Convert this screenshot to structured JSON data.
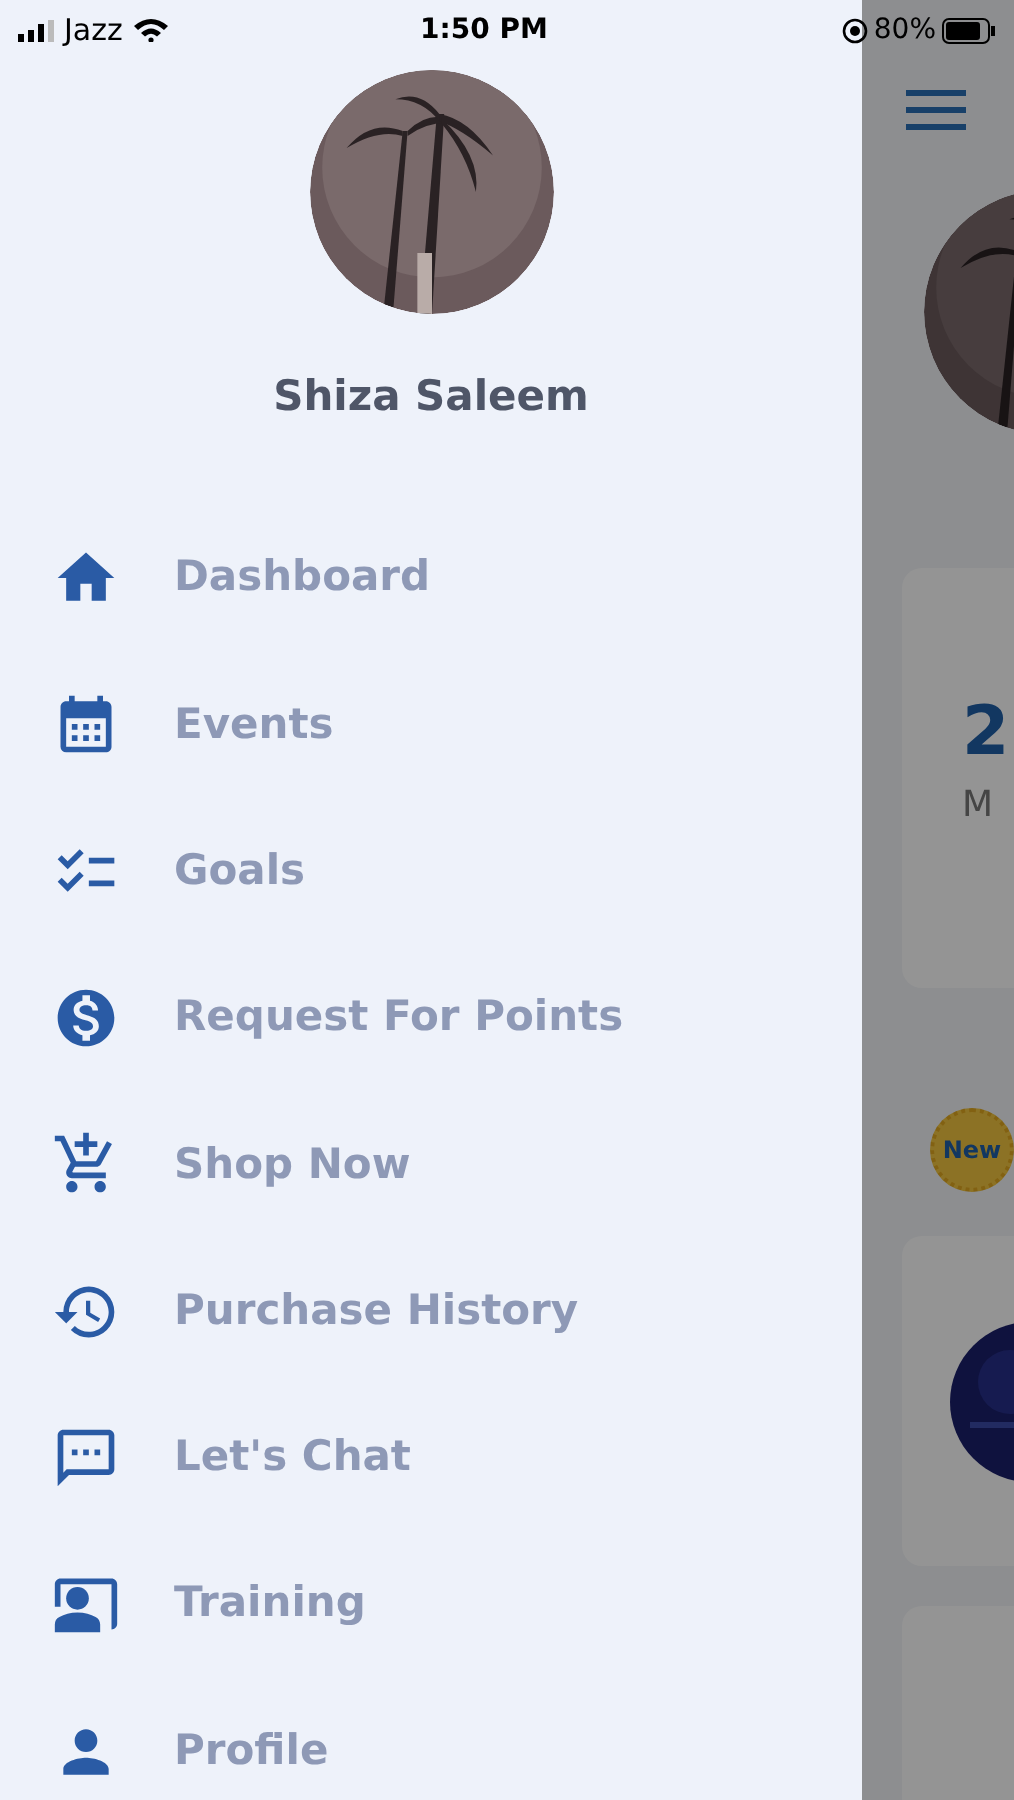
{
  "status_bar": {
    "carrier": "Jazz",
    "time": "1:50 PM",
    "battery": "80%"
  },
  "drawer": {
    "user_name": "Shiza Saleem",
    "items": [
      {
        "label": "Dashboard"
      },
      {
        "label": "Events"
      },
      {
        "label": "Goals"
      },
      {
        "label": "Request For Points"
      },
      {
        "label": "Shop Now"
      },
      {
        "label": "Purchase History"
      },
      {
        "label": "Let's Chat"
      },
      {
        "label": "Training"
      },
      {
        "label": "Profile"
      }
    ]
  },
  "background_page": {
    "stat_value": "2",
    "stat_label": "M",
    "badge": "New"
  }
}
